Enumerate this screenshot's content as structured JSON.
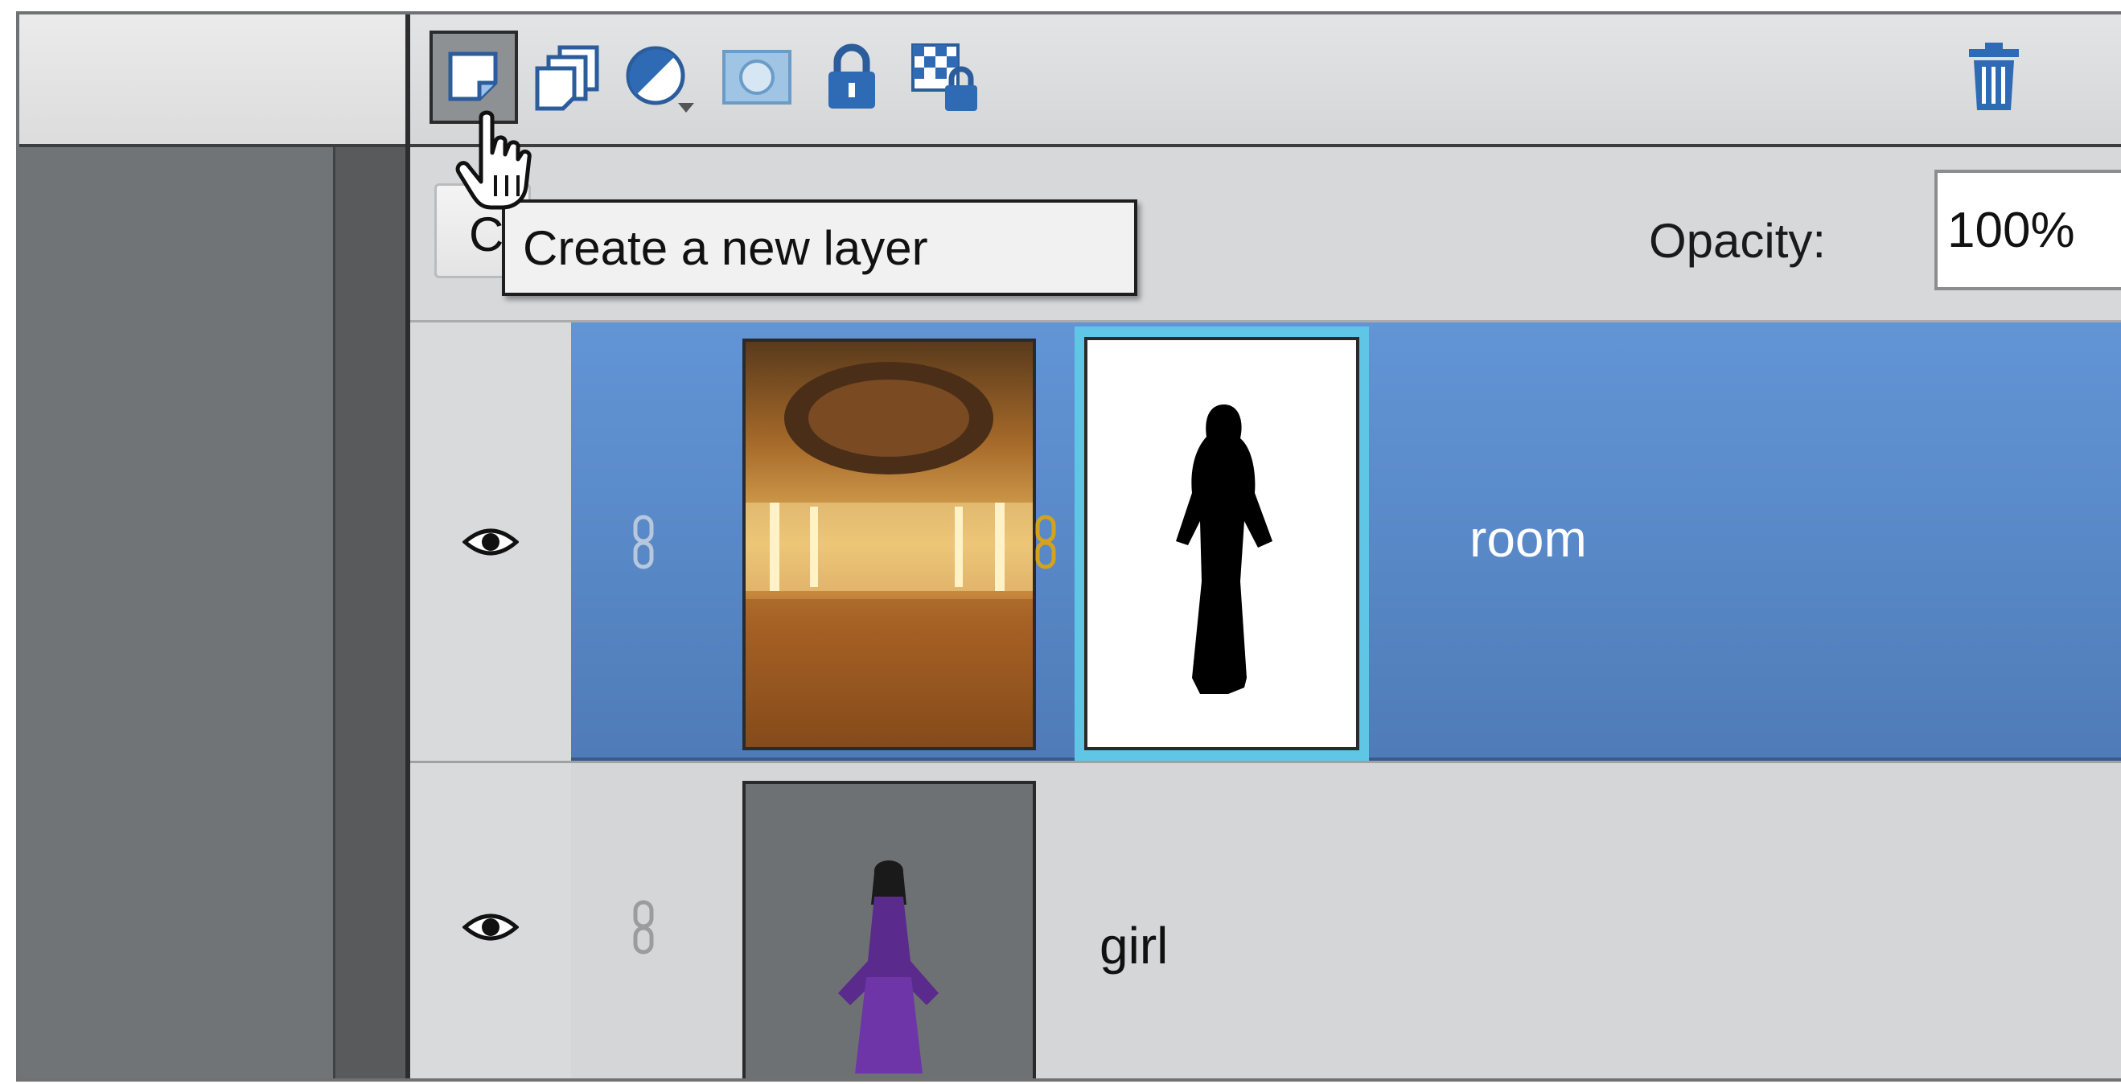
{
  "toolbar": {
    "buttons": [
      {
        "name": "new-layer-icon"
      },
      {
        "name": "duplicate-layers-icon"
      },
      {
        "name": "adjustment-layer-icon"
      },
      {
        "name": "layer-mask-icon"
      },
      {
        "name": "lock-all-icon"
      },
      {
        "name": "lock-transparency-icon"
      },
      {
        "name": "trash-icon"
      }
    ]
  },
  "tooltip": {
    "text": "Create a new layer"
  },
  "options": {
    "blend_mode_partial": "C",
    "opacity_label": "Opacity:",
    "opacity_value": "100%"
  },
  "layers": [
    {
      "name": "room",
      "selected": true,
      "visible": true,
      "has_mask": true
    },
    {
      "name": "girl",
      "selected": false,
      "visible": true,
      "has_mask": false
    }
  ],
  "colors": {
    "selection": "#5b8ac9",
    "mask_highlight": "#5fc6e6",
    "panel": "#d4d6d7"
  }
}
